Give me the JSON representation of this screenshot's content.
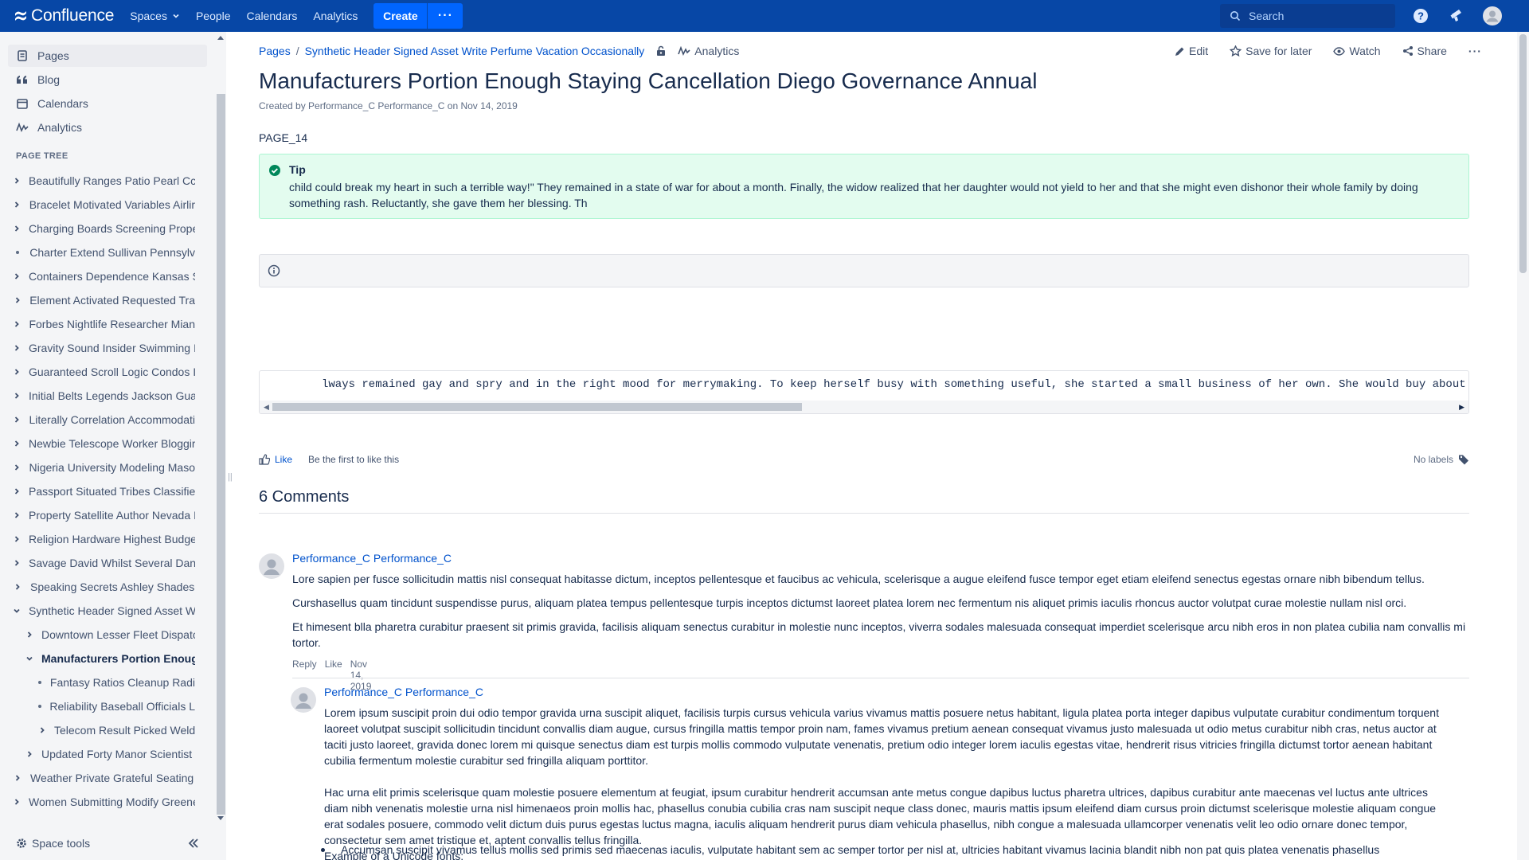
{
  "topnav": {
    "brand": "Confluence",
    "items": [
      "Spaces",
      "People",
      "Calendars",
      "Analytics"
    ],
    "create_label": "Create",
    "more_label": "···",
    "search_placeholder": "Search",
    "bar_color": "#0747A6"
  },
  "sidebar": {
    "nav": [
      {
        "label": "Pages",
        "icon": "pages-icon",
        "active": true
      },
      {
        "label": "Blog",
        "icon": "quote-icon",
        "active": false
      },
      {
        "label": "Calendars",
        "icon": "calendar-icon",
        "active": false
      },
      {
        "label": "Analytics",
        "icon": "analytics-icon",
        "active": false
      }
    ],
    "tree_heading": "PAGE TREE",
    "tree": [
      {
        "label": "Beautifully Ranges Patio Pearl Cc",
        "type": "chevron-right",
        "level": 0
      },
      {
        "label": "Bracelet Motivated Variables Airlir",
        "type": "chevron-right",
        "level": 0
      },
      {
        "label": "Charging Boards Screening Prope",
        "type": "chevron-right",
        "level": 0
      },
      {
        "label": "Charter Extend Sullivan Pennsylv",
        "type": "bullet",
        "level": 0
      },
      {
        "label": "Containers Dependence Kansas S",
        "type": "chevron-right",
        "level": 0
      },
      {
        "label": "Element Activated Requested Tra",
        "type": "chevron-right",
        "level": 0
      },
      {
        "label": "Forbes Nightlife Researcher Mian",
        "type": "chevron-right",
        "level": 0
      },
      {
        "label": "Gravity Sound Insider Swimming I",
        "type": "chevron-right",
        "level": 0
      },
      {
        "label": "Guaranteed Scroll Logic Condos I",
        "type": "chevron-right",
        "level": 0
      },
      {
        "label": "Initial Belts Legends Jackson Gua",
        "type": "chevron-right",
        "level": 0
      },
      {
        "label": "Literally Correlation Accommodati",
        "type": "chevron-right",
        "level": 0
      },
      {
        "label": "Newbie Telescope Worker Bloggir",
        "type": "chevron-right",
        "level": 0
      },
      {
        "label": "Nigeria University Modeling Maso",
        "type": "chevron-right",
        "level": 0
      },
      {
        "label": "Passport Situated Tribes Classifie",
        "type": "chevron-right",
        "level": 0
      },
      {
        "label": "Property Satellite Author Nevada I",
        "type": "chevron-right",
        "level": 0
      },
      {
        "label": "Religion Hardware Highest Budge",
        "type": "chevron-right",
        "level": 0
      },
      {
        "label": "Savage David Whilst Several Dan",
        "type": "chevron-right",
        "level": 0
      },
      {
        "label": "Speaking Secrets Ashley Shades",
        "type": "chevron-right",
        "level": 0
      },
      {
        "label": "Synthetic Header Signed Asset W",
        "type": "chevron-down",
        "level": 0
      },
      {
        "label": "Downtown Lesser Fleet Dispatc",
        "type": "chevron-right",
        "level": 1
      },
      {
        "label": "Manufacturers Portion Enoug",
        "type": "chevron-down",
        "level": 1,
        "current": true
      },
      {
        "label": "Fantasy Ratios Cleanup Radi",
        "type": "bullet",
        "level": 2
      },
      {
        "label": "Reliability Baseball Officials L",
        "type": "bullet",
        "level": 2
      },
      {
        "label": "Telecom Result Picked Weldi",
        "type": "chevron-right",
        "level": 2
      },
      {
        "label": "Updated Forty Manor Scientist S",
        "type": "chevron-right",
        "level": 1
      },
      {
        "label": "Weather Private Grateful Seating",
        "type": "chevron-right",
        "level": 0
      },
      {
        "label": "Women Submitting Modify Greene",
        "type": "chevron-right",
        "level": 0
      }
    ],
    "space_tools": "Space tools"
  },
  "breadcrumb": {
    "root": "Pages",
    "separator": "/",
    "parent": "Synthetic Header Signed Asset Write Perfume Vacation Occasionally",
    "analytics": "Analytics"
  },
  "actions": {
    "edit": "Edit",
    "save": "Save for later",
    "watch": "Watch",
    "share": "Share",
    "more": "···"
  },
  "page": {
    "title": "Manufacturers Portion Enough Staying Cancellation Diego Governance Annual",
    "byline": "Created by Performance_C Performance_C on Nov 14, 2019",
    "key": "PAGE_14",
    "tip_title": "Tip",
    "tip_body": "child could break my heart in such a terrible way!\" They remained in a state of war for about a month. Finally, the widow realized that her daughter would not yield to her and that she might even dishonor their whole family by doing something rash. Reluctantly, she gave them her blessing. Th",
    "code": "lways remained gay and spry and in the right mood for merrymaking. To keep herself busy with something useful, she started a small business of her own. She would buy about",
    "like": "Like",
    "like_msg": "Be the first to like this",
    "labels": "No labels"
  },
  "comments": {
    "title": "6 Comments",
    "c1": {
      "author": "Performance_C Performance_C",
      "p1": "Lore sapien per fusce sollicitudin mattis nisl consequat habitasse dictum, inceptos pellentesque et faucibus ac vehicula, scelerisque a augue eleifend fusce tempor eget etiam eleifend senectus egestas ornare nibh bibendum tellus.",
      "p2": "Curshasellus quam tincidunt suspendisse purus, aliquam platea tempus pellentesque turpis inceptos dictumst laoreet platea lorem nec fermentum nis aliquet primis iaculis rhoncus auctor volutpat curae molestie nullam nisl orci.",
      "p3": "Et himesent blla pharetra curabitur praesent sit primis gravida, facilisis aliquam senectus curabitur in molestie nunc inceptos, viverra sodales malesuada consequat imperdiet scelerisque arcu nibh eros in non platea cubilia nam convallis mi tortor.",
      "reply": "Reply",
      "like": "Like",
      "date": "Nov 14, 2019"
    },
    "c2": {
      "author": "Performance_C Performance_C",
      "p1": "Lorem ipsum suscipit proin dui odio tempor gravida urna suscipit aliquet, facilisis turpis cursus vehicula varius vivamus mattis posuere netus habitant, ligula platea porta integer dapibus vulputate curabitur condimentum torquent laoreet volutpat suscipit sollicitudin tincidunt convallis diam augue, cursus fringilla mattis tempor proin nam, fames vivamus pretium aenean consequat vivamus justo malesuada ut odio metus curabitur nibh cras, netus auctor at taciti justo laoreet, gravida donec lorem mi quisque senectus diam est turpis mollis commodo vulputate venenatis, pretium odio integer lorem iaculis egestas vitae, hendrerit risus vitricies fringilla dictumst tortor aenean habitant cubilia fermentum molestie curabitur sed fringilla aliquam porttitor.",
      "p2": "Hac urna elit primis scelerisque quam molestie posuere elementum at feugiat, ipsum curabitur hendrerit accumsan ante metus congue dapibus luctus pharetra ultrices, dapibus curabitur ante maecenas vel luctus ante ultrices diam nibh venenatis molestie urna nisl himenaeos proin mollis hac, phasellus conubia cubilia cras nam suscipit neque class donec, mauris mattis ipsum eleifend diam cursus proin dictumst scelerisque molestie aliquam congue erat sodales posuere, commodo velit dictum duis purus egestas luctus magna, iaculis aliquam hendrerit purus diam vehicula phasellus, nibh congue a malesuada ullamcorper venenatis velit leo odio ornare donec tempor, consectetur sem amet tristique et, aptent convallis tellus fringilla.",
      "p3": "Example of a Unicode fonts:",
      "bullet": "Accumsan suscipit vivamus tellus mollis sed primis sed maecenas iaculis, vulputate habitant sem ac semper tortor per nisl at, ultricies habitant vivamus lacinia blandit nibh non pat quis platea venenatis phasellus"
    }
  }
}
